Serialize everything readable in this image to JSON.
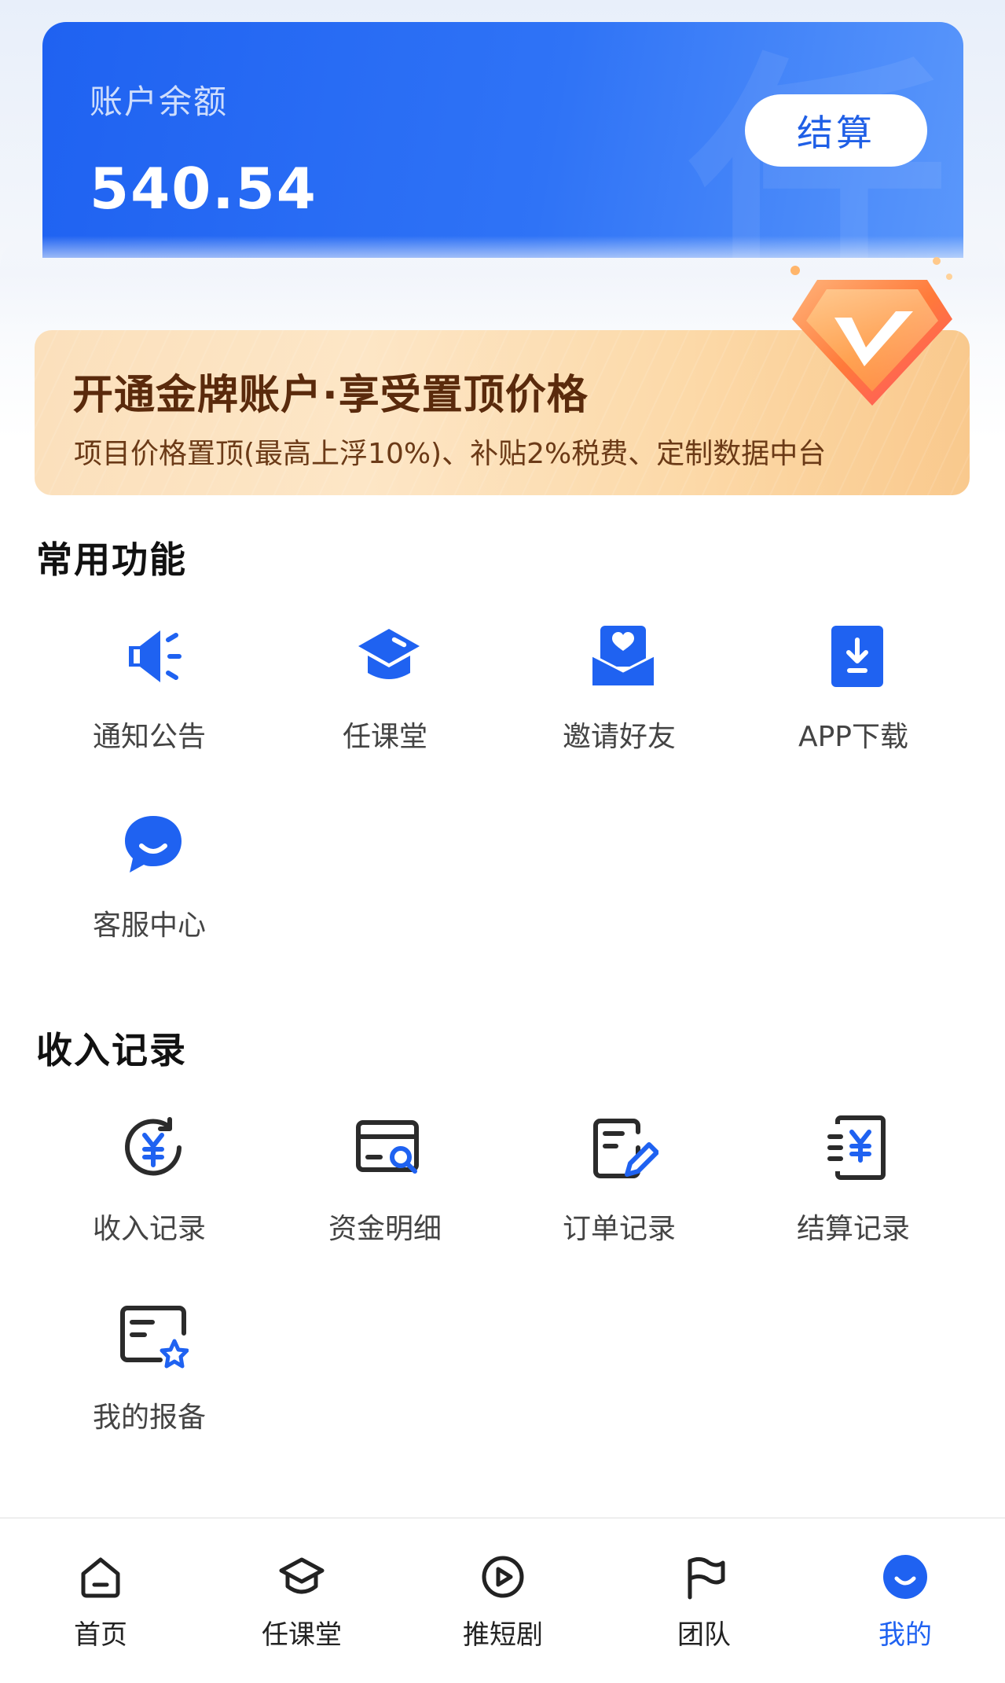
{
  "balance": {
    "label": "账户余额",
    "value": "540.54",
    "settle_button": "结算",
    "watermark": "任"
  },
  "banner": {
    "title": "开通金牌账户·享受置顶价格",
    "subtitle": "项目价格置顶(最高上浮10%)、补贴2%税费、定制数据中台",
    "badge_icon": "gold-v-badge-icon"
  },
  "common_functions": {
    "title": "常用功能",
    "items": [
      {
        "label": "通知公告",
        "icon": "megaphone-icon"
      },
      {
        "label": "任课堂",
        "icon": "graduation-cap-icon"
      },
      {
        "label": "邀请好友",
        "icon": "invite-envelope-icon"
      },
      {
        "label": "APP下载",
        "icon": "download-icon"
      },
      {
        "label": "客服中心",
        "icon": "customer-service-icon"
      }
    ]
  },
  "income_records": {
    "title": "收入记录",
    "items": [
      {
        "label": "收入记录",
        "icon": "yuan-refresh-icon"
      },
      {
        "label": "资金明细",
        "icon": "card-search-icon"
      },
      {
        "label": "订单记录",
        "icon": "document-edit-icon"
      },
      {
        "label": "结算记录",
        "icon": "yuan-receipt-icon"
      },
      {
        "label": "我的报备",
        "icon": "card-star-icon"
      }
    ]
  },
  "bottom_nav": [
    {
      "label": "首页",
      "icon": "home-icon",
      "active": false
    },
    {
      "label": "任课堂",
      "icon": "course-icon",
      "active": false
    },
    {
      "label": "推短剧",
      "icon": "play-icon",
      "active": false
    },
    {
      "label": "团队",
      "icon": "flag-icon",
      "active": false
    },
    {
      "label": "我的",
      "icon": "profile-icon",
      "active": true
    }
  ],
  "colors": {
    "primary": "#1f62f1",
    "banner_text": "#5a2a0c"
  }
}
